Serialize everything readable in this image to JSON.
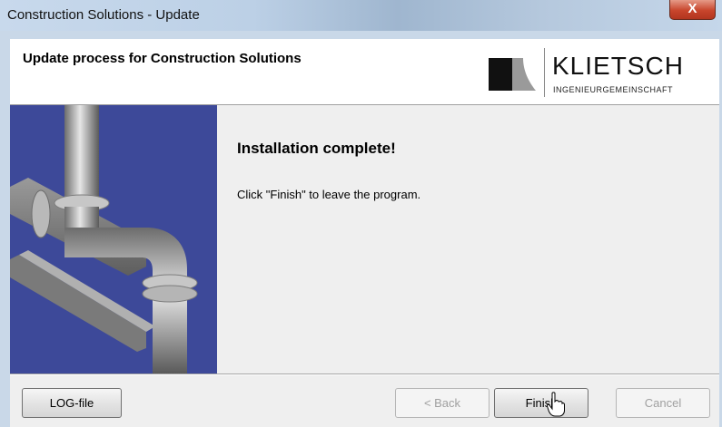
{
  "window": {
    "title": "Construction Solutions - Update",
    "close_label": "X"
  },
  "header": {
    "title": "Update process for Construction Solutions",
    "logo_name": "KLIETSCH",
    "logo_subtitle": "INGENIEURGEMEINSCHAFT"
  },
  "content": {
    "heading": "Installation complete!",
    "message": "Click \"Finish\" to leave the program."
  },
  "buttons": {
    "log": "LOG-file",
    "back": "< Back",
    "finish": "Finish",
    "cancel": "Cancel"
  },
  "colors": {
    "banner_background": "#3d4999",
    "close_button": "#c8452c"
  }
}
